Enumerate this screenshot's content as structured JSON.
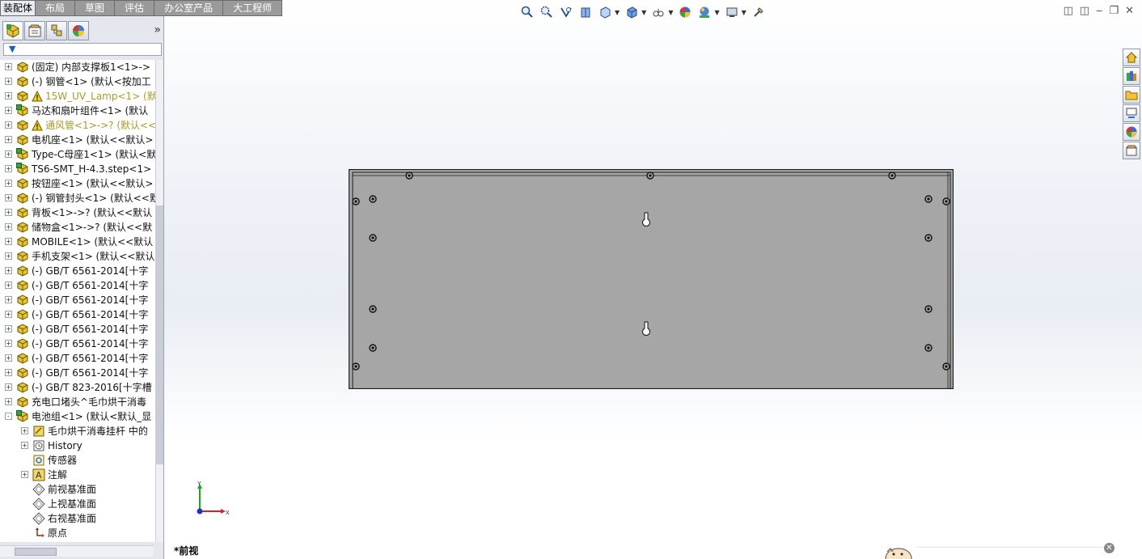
{
  "tabs": [
    {
      "label": "装配体",
      "active": true
    },
    {
      "label": "布局"
    },
    {
      "label": "草图"
    },
    {
      "label": "评估"
    },
    {
      "label": "办公室产品"
    },
    {
      "label": "大工程师"
    }
  ],
  "feature_tree": {
    "items": [
      {
        "label": "(固定) 内部支撑板1<1>->",
        "icon": "part-icon",
        "expand": "+"
      },
      {
        "label": "(-) 钢管<1> (默认<按加工",
        "icon": "part-icon",
        "expand": "+"
      },
      {
        "label": "15W_UV_Lamp<1> (默",
        "icon": "part-icon",
        "expand": "+",
        "warning": true
      },
      {
        "label": "马达和扇叶组件<1> (默认",
        "icon": "assembly-icon",
        "expand": "+"
      },
      {
        "label": "通风管<1>->? (默认<<",
        "icon": "part-icon",
        "expand": "+",
        "warning": true
      },
      {
        "label": "电机座<1> (默认<<默认>",
        "icon": "part-icon",
        "expand": "+"
      },
      {
        "label": "Type-C母座1<1> (默认<默",
        "icon": "assembly-icon",
        "expand": "+"
      },
      {
        "label": "TS6-SMT_H-4.3.step<1>",
        "icon": "assembly-icon",
        "expand": "+"
      },
      {
        "label": "按钮座<1> (默认<<默认>",
        "icon": "part-icon",
        "expand": "+"
      },
      {
        "label": "(-) 钢管封头<1> (默认<<默",
        "icon": "part-icon",
        "expand": "+"
      },
      {
        "label": "背板<1>->? (默认<<默认",
        "icon": "part-icon",
        "expand": "+"
      },
      {
        "label": "储物盒<1>->? (默认<<默",
        "icon": "part-icon",
        "expand": "+"
      },
      {
        "label": "MOBILE<1> (默认<<默认",
        "icon": "part-icon",
        "expand": "+"
      },
      {
        "label": "手机支架<1> (默认<<默认",
        "icon": "part-icon",
        "expand": "+"
      },
      {
        "label": "(-) GB/T 6561-2014[十字",
        "icon": "part-icon",
        "expand": "+"
      },
      {
        "label": "(-) GB/T 6561-2014[十字",
        "icon": "part-icon",
        "expand": "+"
      },
      {
        "label": "(-) GB/T 6561-2014[十字",
        "icon": "part-icon",
        "expand": "+"
      },
      {
        "label": "(-) GB/T 6561-2014[十字",
        "icon": "part-icon",
        "expand": "+"
      },
      {
        "label": "(-) GB/T 6561-2014[十字",
        "icon": "part-icon",
        "expand": "+"
      },
      {
        "label": "(-) GB/T 6561-2014[十字",
        "icon": "part-icon",
        "expand": "+"
      },
      {
        "label": "(-) GB/T 6561-2014[十字",
        "icon": "part-icon",
        "expand": "+"
      },
      {
        "label": "(-) GB/T 6561-2014[十字",
        "icon": "part-icon",
        "expand": "+"
      },
      {
        "label": "(-) GB/T 823-2016[十字槽",
        "icon": "part-icon",
        "expand": "+"
      },
      {
        "label": "充电口堵头^毛巾烘干消毒",
        "icon": "part-icon",
        "expand": "+"
      },
      {
        "label": "电池组<1> (默认<默认_显",
        "icon": "assembly-icon",
        "expand": "-"
      },
      {
        "label": "毛巾烘干消毒挂杆 中的",
        "icon": "reference-icon",
        "expand": "+",
        "child": true
      },
      {
        "label": "History",
        "icon": "history-icon",
        "expand": "+",
        "child": true
      },
      {
        "label": "传感器",
        "icon": "sensor-icon",
        "child": true
      },
      {
        "label": "注解",
        "icon": "annotation-icon",
        "expand": "+",
        "child": true
      },
      {
        "label": "前视基准面",
        "icon": "plane-icon",
        "child": true
      },
      {
        "label": "上视基准面",
        "icon": "plane-icon",
        "child": true
      },
      {
        "label": "右视基准面",
        "icon": "plane-icon",
        "child": true
      },
      {
        "label": "原点",
        "icon": "origin-icon",
        "child": true
      }
    ]
  },
  "viewport": {
    "view_name": "*前视",
    "triad": {
      "x": "X",
      "y": "Y"
    }
  },
  "colors": {
    "plate": "#a6a6a6",
    "tab_inactive": "#9a9a9a",
    "panel_bg": "#e4e7ee"
  }
}
